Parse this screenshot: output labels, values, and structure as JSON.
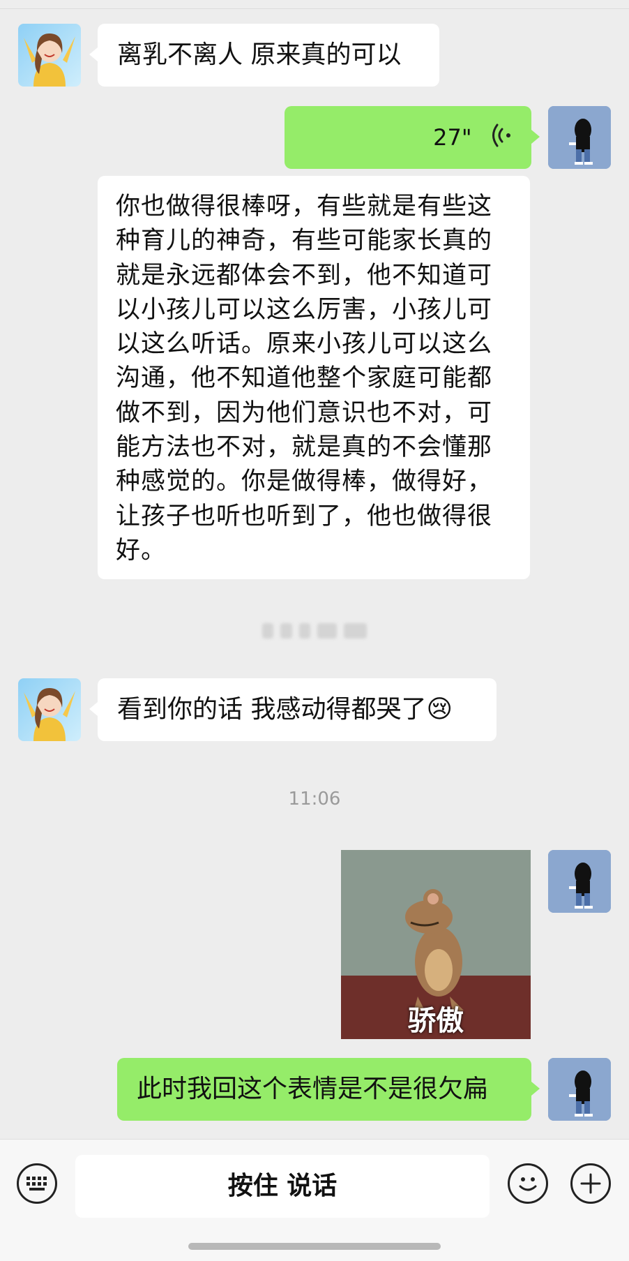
{
  "chat": {
    "messages": [
      {
        "from": "other",
        "text": "离乳不离人 原来真的可以"
      },
      {
        "from": "me",
        "type": "voice",
        "duration": "27\""
      },
      {
        "from": "other",
        "text": "你也做得很棒呀，有些就是有些这种育儿的神奇，有些可能家长真的就是永远都体会不到，他不知道可以小孩儿可以这么厉害，小孩儿可以这么听话。原来小孩儿可以这么沟通，他不知道他整个家庭可能都做不到，因为他们意识也不对，可能方法也不对，就是真的不会懂那种感觉的。你是做得棒，做得好，让孩子也听也听到了，他也做得很好。"
      },
      {
        "from": "other",
        "text": "看到你的话 我感动得都哭了",
        "emoji": "😢"
      },
      {
        "from": "me",
        "type": "sticker",
        "caption": "骄傲"
      },
      {
        "from": "me",
        "text": "此时我回这个表情是不是很欠扁"
      }
    ],
    "timestamp": "11:06"
  },
  "input_bar": {
    "hold_to_talk_label": "按住 说话",
    "left_icon": "keyboard-icon",
    "right_icons": [
      "emoji-icon",
      "plus-icon"
    ]
  },
  "colors": {
    "background": "#ededed",
    "my_bubble": "#95ec69",
    "other_bubble": "#ffffff",
    "timestamp_text": "#9a9a9a"
  }
}
